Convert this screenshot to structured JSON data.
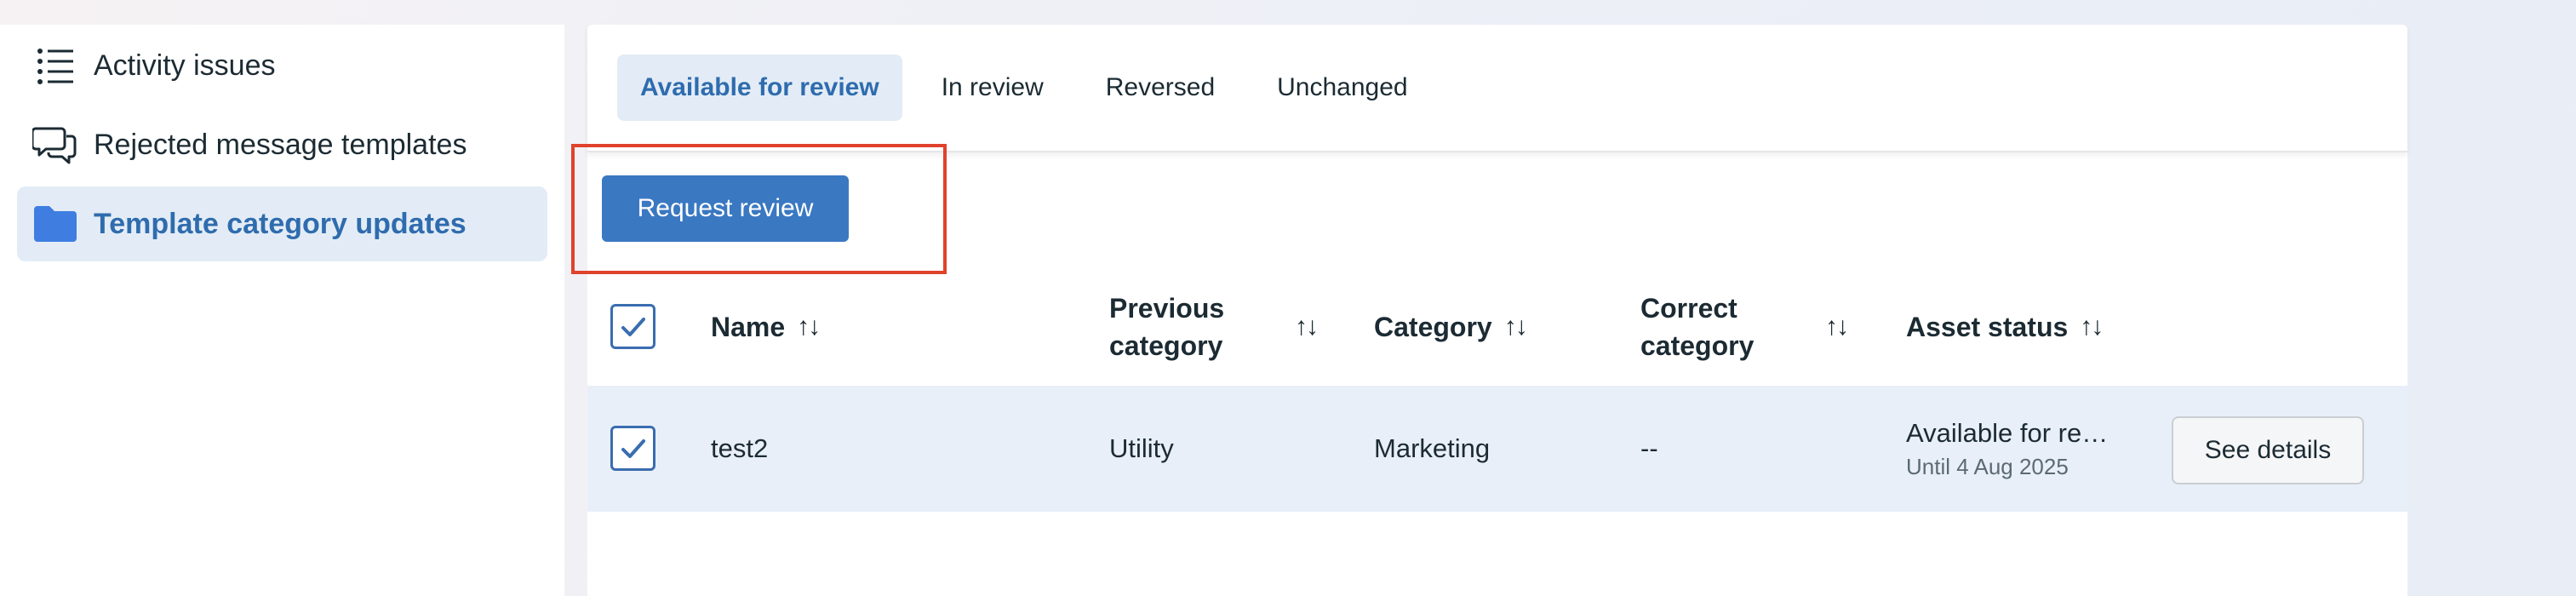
{
  "sidebar": {
    "items": [
      {
        "label": "Activity issues",
        "icon": "list-icon",
        "active": false
      },
      {
        "label": "Rejected message templates",
        "icon": "chat-bubbles-icon",
        "active": false
      },
      {
        "label": "Template category updates",
        "icon": "folder-icon",
        "active": true
      }
    ]
  },
  "tabs": [
    {
      "label": "Available for review",
      "active": true
    },
    {
      "label": "In review",
      "active": false
    },
    {
      "label": "Reversed",
      "active": false
    },
    {
      "label": "Unchanged",
      "active": false
    }
  ],
  "toolbar": {
    "request_review_label": "Request review"
  },
  "table": {
    "header_checkbox_checked": true,
    "columns": {
      "name": "Name",
      "previous_category_line1": "Previous",
      "previous_category_line2": "category",
      "category": "Category",
      "correct_category_line1": "Correct",
      "correct_category_line2": "category",
      "asset_status": "Asset status"
    },
    "sort_glyph": "↑↓",
    "rows": [
      {
        "checked": true,
        "name": "test2",
        "previous_category": "Utility",
        "category": "Marketing",
        "correct_category": "--",
        "asset_status": "Available for re…",
        "asset_status_sub": "Until 4 Aug 2025",
        "action_label": "See details"
      }
    ]
  },
  "colors": {
    "accent": "#3a78c2",
    "active_bg": "#e3ecf6",
    "active_text": "#2f6cae",
    "row_bg": "#e9eff8",
    "highlight": "#e0422c"
  }
}
